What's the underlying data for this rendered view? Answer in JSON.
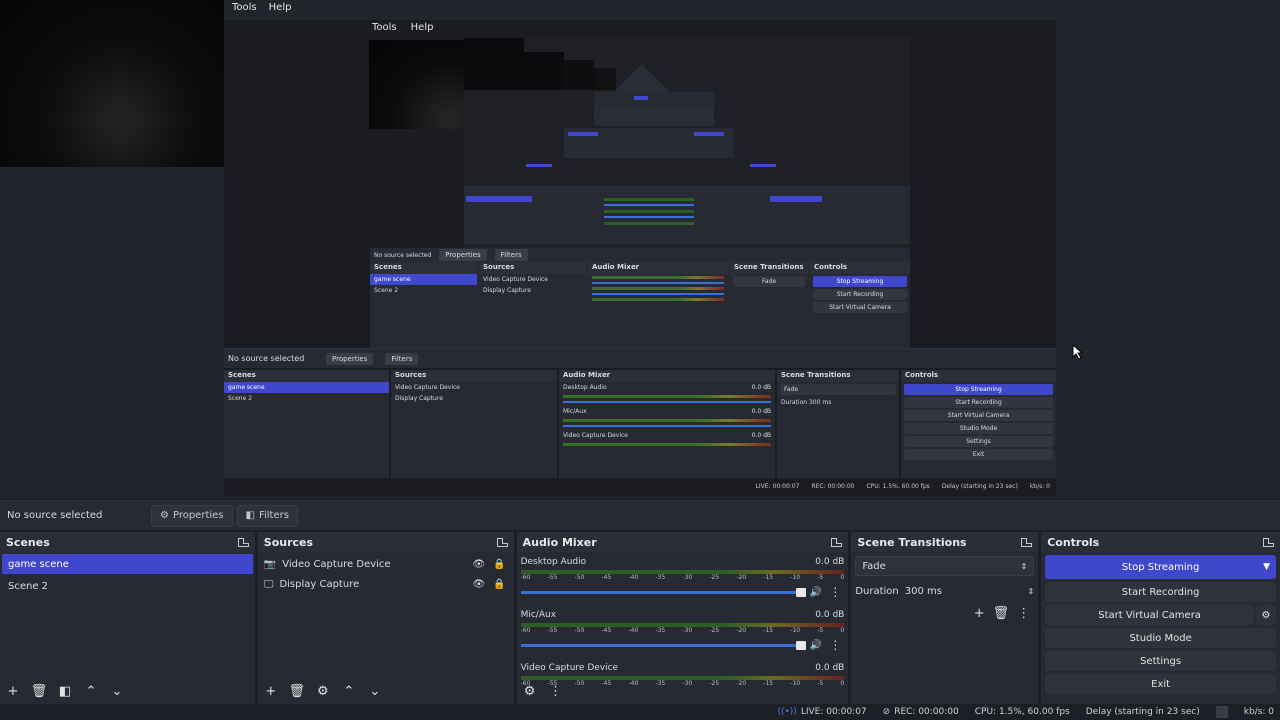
{
  "menu": {
    "tools": "Tools",
    "help": "Help"
  },
  "nested": {
    "menu": {
      "tools": "Tools",
      "help": "Help"
    },
    "no_source": "No source selected",
    "properties": "Properties",
    "filters": "Filters",
    "scenes_title": "Scenes",
    "sources_title": "Sources",
    "mixer_title": "Audio Mixer",
    "transitions_title": "Scene Transitions",
    "controls_title": "Controls",
    "scene1": "game scene",
    "scene2": "Scene 2",
    "src1": "Video Capture Device",
    "src2": "Display Capture",
    "desktop_audio": "Desktop Audio",
    "mic": "Mic/Aux",
    "video_capture": "Video Capture Device",
    "db": "0.0 dB",
    "fade": "Fade",
    "duration_label": "Duration",
    "duration_value": "300 ms",
    "stop_streaming": "Stop Streaming",
    "start_recording": "Start Recording",
    "start_virtual_camera": "Start Virtual Camera",
    "studio_mode": "Studio Mode",
    "settings": "Settings",
    "exit": "Exit",
    "live": "LIVE: 00:00:07",
    "rec": "REC: 00:00:00",
    "cpu": "CPU: 1.5%, 60.00 fps",
    "delay": "Delay (starting in 23 sec)",
    "kbps": "kb/s: 0"
  },
  "source_bar": {
    "no_source": "No source selected",
    "properties": "Properties",
    "filters": "Filters"
  },
  "scenes": {
    "title": "Scenes",
    "items": [
      "game scene",
      "Scene 2"
    ]
  },
  "sources": {
    "title": "Sources",
    "items": [
      "Video Capture Device",
      "Display Capture"
    ]
  },
  "mixer": {
    "title": "Audio Mixer",
    "channels": [
      {
        "name": "Desktop Audio",
        "level": "0.0 dB"
      },
      {
        "name": "Mic/Aux",
        "level": "0.0 dB"
      },
      {
        "name": "Video Capture Device",
        "level": "0.0 dB"
      }
    ],
    "ticks": [
      "-60",
      "-55",
      "-50",
      "-45",
      "-40",
      "-35",
      "-30",
      "-25",
      "-20",
      "-15",
      "-10",
      "-5",
      "0"
    ]
  },
  "transitions": {
    "title": "Scene Transitions",
    "type": "Fade",
    "duration_label": "Duration",
    "duration_value": "300 ms"
  },
  "controls": {
    "title": "Controls",
    "stop_streaming": "Stop Streaming",
    "start_recording": "Start Recording",
    "start_virtual_camera": "Start Virtual Camera",
    "studio_mode": "Studio Mode",
    "settings": "Settings",
    "exit": "Exit"
  },
  "status": {
    "live": "LIVE: 00:00:07",
    "rec": "REC: 00:00:00",
    "cpu": "CPU: 1.5%, 60.00 fps",
    "delay": "Delay (starting in 23 sec)",
    "kbps": "kb/s: 0"
  },
  "colors": {
    "accent": "#3f48cc",
    "panel": "#272a33",
    "background": "#1d1f26"
  }
}
